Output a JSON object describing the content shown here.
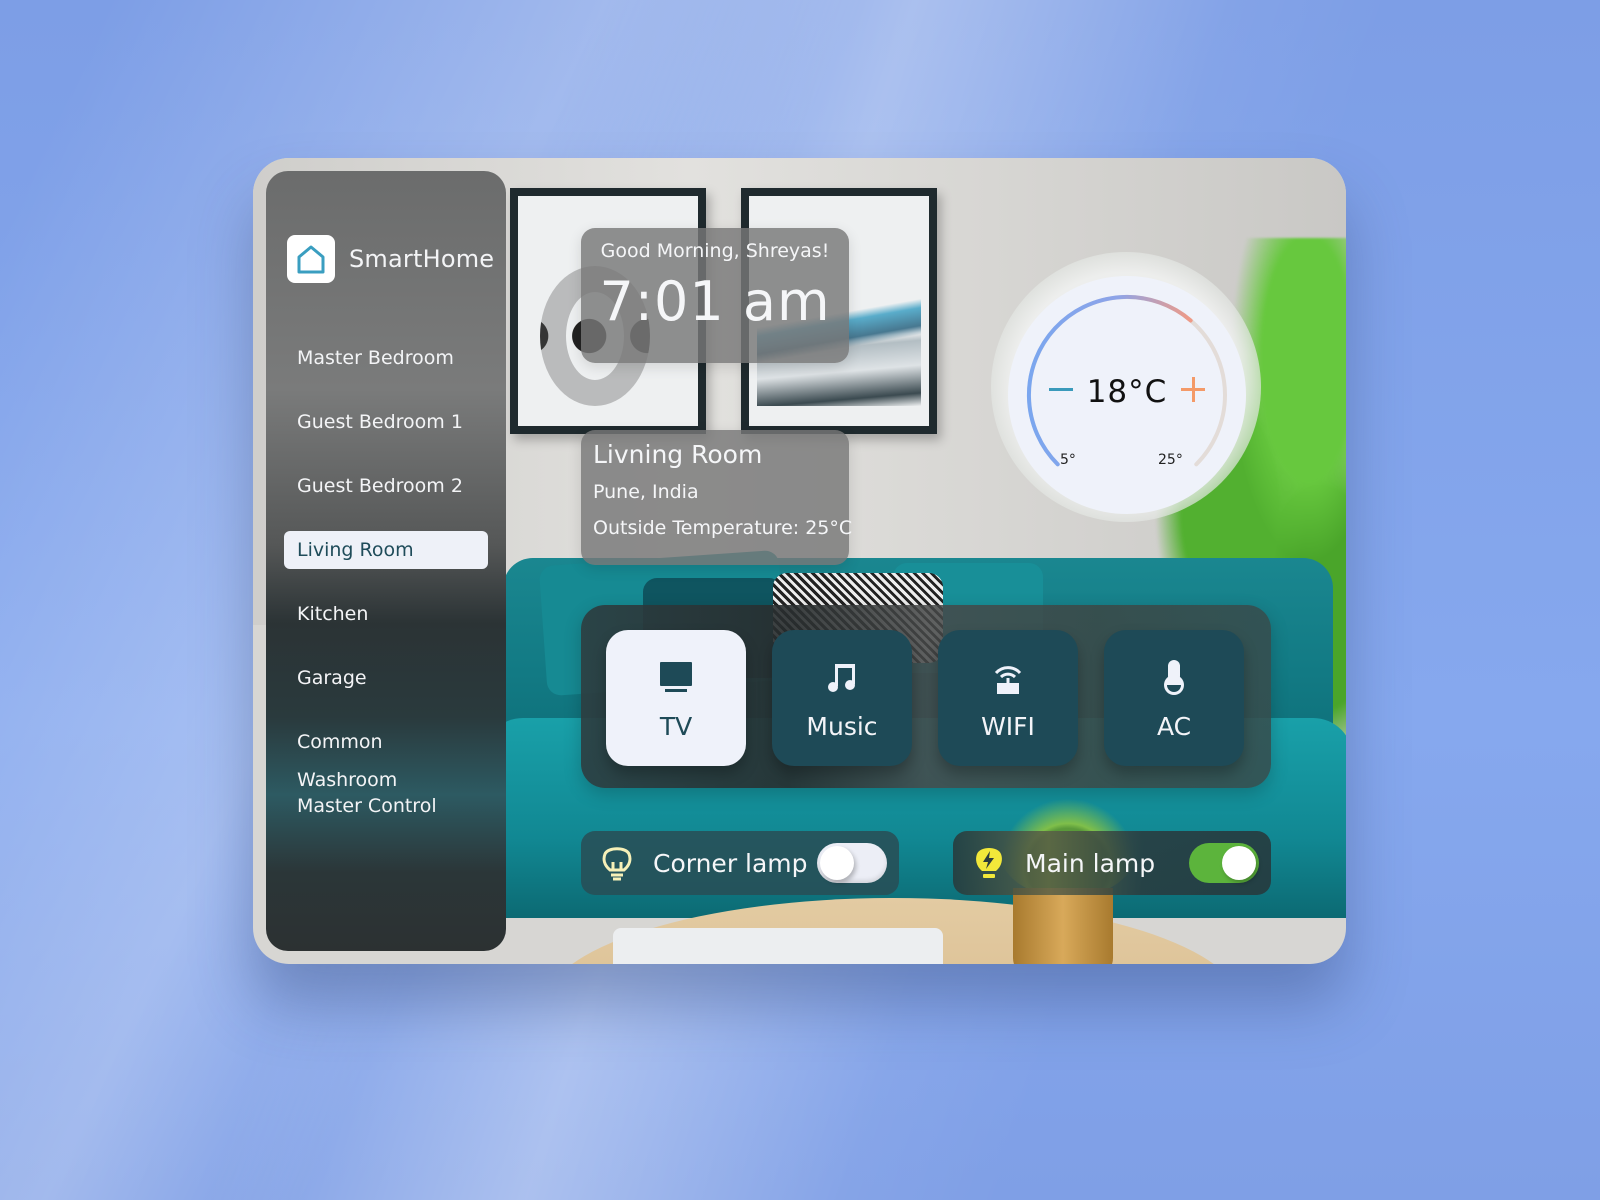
{
  "app": {
    "name": "SmartHome",
    "logo_icon": "house-icon"
  },
  "sidebar": {
    "items": [
      {
        "label": "Master Bedroom",
        "active": false
      },
      {
        "label": "Guest Bedroom 1",
        "active": false
      },
      {
        "label": "Guest Bedroom 2",
        "active": false
      },
      {
        "label": "Living Room",
        "active": true
      },
      {
        "label": "Kitchen",
        "active": false
      },
      {
        "label": "Garage",
        "active": false
      },
      {
        "label": "Common Washroom",
        "active": false
      },
      {
        "label": "Master Control",
        "active": false
      }
    ]
  },
  "greeting": {
    "text": "Good Morning, Shreyas!",
    "time": "7:01 am"
  },
  "room": {
    "title": "Livning Room",
    "location": "Pune, India",
    "outside_temperature": "Outside Temperature: 25°C"
  },
  "thermostat": {
    "value_label": "18°C",
    "value": 18,
    "min": 5,
    "max": 25,
    "min_label": "5°",
    "max_label": "25°",
    "minus_icon": "minus-icon",
    "plus_icon": "plus-icon",
    "colors": {
      "cool": "#7aa6ef",
      "warm": "#ef9a86",
      "track": "#e3dcd8",
      "minus": "#3a9abb",
      "plus": "#f49a68"
    }
  },
  "devices": [
    {
      "label": "TV",
      "icon": "tv-icon",
      "active": true
    },
    {
      "label": "Music",
      "icon": "music-note-icon",
      "active": false
    },
    {
      "label": "WIFI",
      "icon": "router-icon",
      "active": false
    },
    {
      "label": "AC",
      "icon": "thermometer-icon",
      "active": false
    }
  ],
  "lamps": [
    {
      "label": "Corner lamp",
      "icon": "lightbulb-outline-icon",
      "on": false
    },
    {
      "label": "Main lamp",
      "icon": "lightbulb-bolt-icon",
      "on": true
    }
  ],
  "colors": {
    "accent_dark": "#1e4a57",
    "tile_light": "#eff2fa",
    "toggle_on": "#5cb43c",
    "bulb_on": "#f2e83a",
    "bulb_off": "#f6f0b8",
    "background": "#7d9ee6"
  }
}
